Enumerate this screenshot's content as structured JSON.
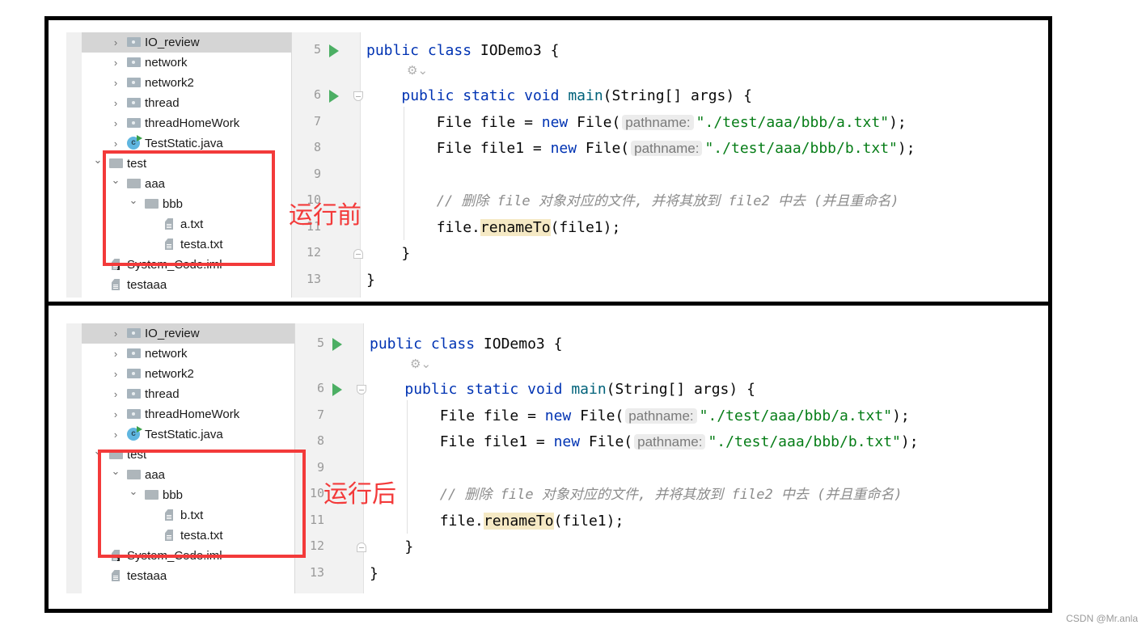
{
  "panels": [
    {
      "id": "before",
      "caption": "运行前",
      "tree": [
        {
          "label": "IO_review",
          "type": "folder-src",
          "depth": 2,
          "expanded": false,
          "selected": true
        },
        {
          "label": "network",
          "type": "folder-src",
          "depth": 2,
          "expanded": false
        },
        {
          "label": "network2",
          "type": "folder-src",
          "depth": 2,
          "expanded": false
        },
        {
          "label": "thread",
          "type": "folder-src",
          "depth": 2,
          "expanded": false
        },
        {
          "label": "threadHomeWork",
          "type": "folder-src",
          "depth": 2,
          "expanded": false
        },
        {
          "label": "TestStatic.java",
          "type": "class",
          "depth": 2,
          "expanded": false
        },
        {
          "label": "test",
          "type": "folder",
          "depth": 1,
          "expanded": true
        },
        {
          "label": "aaa",
          "type": "folder",
          "depth": 2,
          "expanded": true
        },
        {
          "label": "bbb",
          "type": "folder",
          "depth": 3,
          "expanded": true
        },
        {
          "label": "a.txt",
          "type": "file",
          "depth": 4
        },
        {
          "label": "testa.txt",
          "type": "file",
          "depth": 4
        },
        {
          "label": "System_Code.iml",
          "type": "iml",
          "depth": 1
        },
        {
          "label": "testaaa",
          "type": "file",
          "depth": 1
        }
      ],
      "b_path": "./test/aaa/bbb/b.txt"
    },
    {
      "id": "after",
      "caption": "运行后",
      "tree": [
        {
          "label": "IO_review",
          "type": "folder-src",
          "depth": 2,
          "expanded": false,
          "selected": true
        },
        {
          "label": "network",
          "type": "folder-src",
          "depth": 2,
          "expanded": false
        },
        {
          "label": "network2",
          "type": "folder-src",
          "depth": 2,
          "expanded": false
        },
        {
          "label": "thread",
          "type": "folder-src",
          "depth": 2,
          "expanded": false
        },
        {
          "label": "threadHomeWork",
          "type": "folder-src",
          "depth": 2,
          "expanded": false
        },
        {
          "label": "TestStatic.java",
          "type": "class",
          "depth": 2,
          "expanded": false
        },
        {
          "label": "test",
          "type": "folder",
          "depth": 1,
          "expanded": true
        },
        {
          "label": "aaa",
          "type": "folder",
          "depth": 2,
          "expanded": true
        },
        {
          "label": "bbb",
          "type": "folder",
          "depth": 3,
          "expanded": true
        },
        {
          "label": "b.txt",
          "type": "file",
          "depth": 4
        },
        {
          "label": "testa.txt",
          "type": "file",
          "depth": 4
        },
        {
          "label": "System_Code.iml",
          "type": "iml",
          "depth": 1
        },
        {
          "label": "testaaa",
          "type": "file",
          "depth": 1
        }
      ]
    }
  ],
  "code": {
    "line_numbers": [
      "5",
      "6",
      "7",
      "8",
      "9",
      "10",
      "11",
      "12",
      "13"
    ],
    "kw_public": "public",
    "kw_class": "class",
    "class_name": "IODemo3",
    "open_brace": " {",
    "kw_static": "static",
    "kw_void": "void",
    "method_main": "main",
    "main_params": "(String[] args) {",
    "type_file": "File",
    "var_file": " file = ",
    "var_file1": " file1 = ",
    "kw_new": "new",
    "ctor_open": " File(",
    "hint_pathname": "pathname:",
    "str_a": "\"./test/aaa/bbb/a.txt\"",
    "str_b": "\"./test/aaa/bbb/b.txt\"",
    "stmt_end": ");",
    "comment": "// 删除 file 对象对应的文件, 并将其放到 file2 中去 (并且重命名)",
    "call_obj": "file.",
    "call_method": "renameTo",
    "call_args": "(file1);",
    "close_brace": "}",
    "lens_icon": "⚙⌄"
  },
  "watermark": "CSDN @Mr.anla"
}
